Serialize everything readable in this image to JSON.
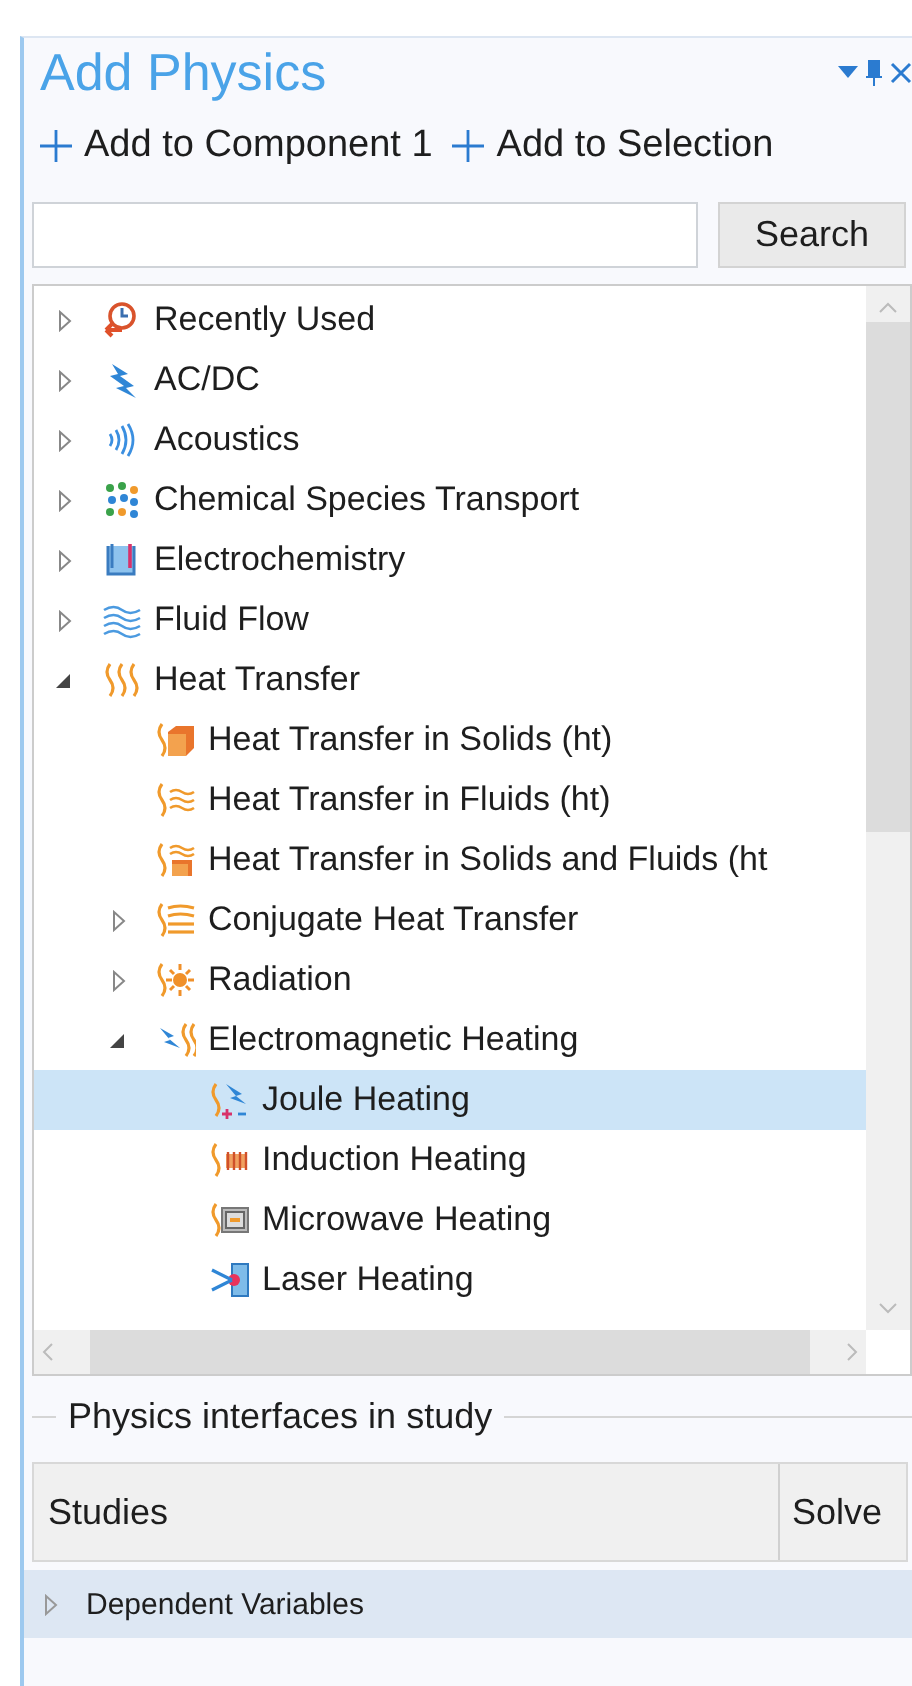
{
  "window": {
    "title": "Add Physics"
  },
  "actions": [
    {
      "label": "Add to Component 1"
    },
    {
      "label": "Add to Selection"
    }
  ],
  "search": {
    "button": "Search"
  },
  "tree": [
    {
      "label": "Recently Used",
      "expanded": false,
      "selected": false
    },
    {
      "label": "AC/DC",
      "expanded": false,
      "selected": false
    },
    {
      "label": "Acoustics",
      "expanded": false,
      "selected": false
    },
    {
      "label": "Chemical Species Transport",
      "expanded": false,
      "selected": false
    },
    {
      "label": "Electrochemistry",
      "expanded": false,
      "selected": false
    },
    {
      "label": "Fluid Flow",
      "expanded": false,
      "selected": false
    },
    {
      "label": "Heat Transfer",
      "expanded": true,
      "selected": false,
      "children": [
        {
          "label": "Heat Transfer in Solids (ht)",
          "kind": "leaf",
          "selected": false
        },
        {
          "label": "Heat Transfer in Fluids (ht)",
          "kind": "leaf",
          "selected": false
        },
        {
          "label": "Heat Transfer in Solids and Fluids (ht",
          "kind": "leaf",
          "selected": false
        },
        {
          "label": "Conjugate Heat Transfer",
          "expanded": false,
          "selected": false
        },
        {
          "label": "Radiation",
          "expanded": false,
          "selected": false
        },
        {
          "label": "Electromagnetic Heating",
          "expanded": true,
          "selected": false,
          "children": [
            {
              "label": "Joule Heating",
              "kind": "leaf",
              "selected": true
            },
            {
              "label": "Induction Heating",
              "kind": "leaf",
              "selected": false
            },
            {
              "label": "Microwave Heating",
              "kind": "leaf",
              "selected": false
            },
            {
              "label": "Laser Heating",
              "kind": "leaf",
              "selected": false
            }
          ]
        }
      ]
    }
  ],
  "study_group": {
    "title": "Physics interfaces in study",
    "columns": [
      "Studies",
      "Solve"
    ]
  },
  "dependent_variables": {
    "label": "Dependent Variables",
    "expanded": false
  }
}
